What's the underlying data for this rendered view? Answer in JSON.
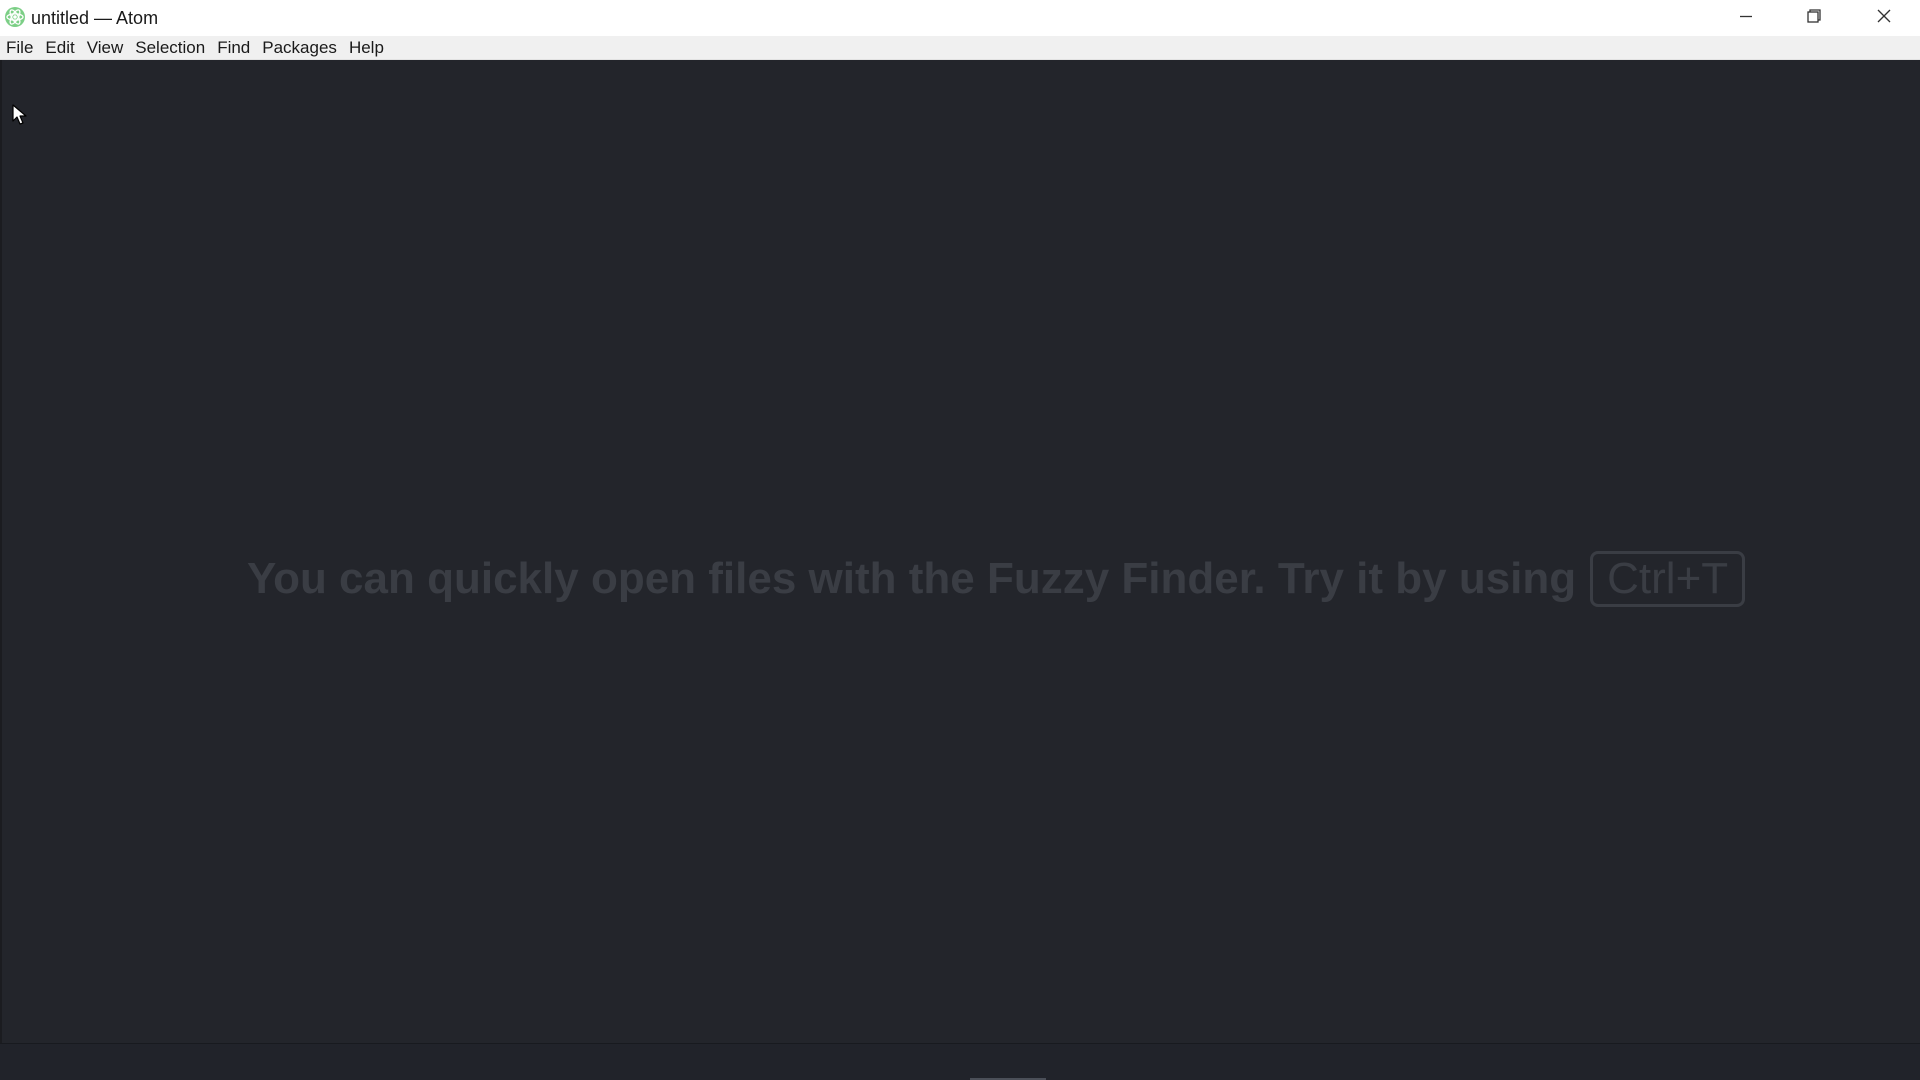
{
  "window": {
    "title": "untitled — Atom",
    "app_icon": "atom-logo-icon",
    "controls": {
      "minimize": "minimize-icon",
      "maximize": "restore-icon",
      "close": "close-icon"
    }
  },
  "menubar": {
    "items": [
      {
        "label": "File"
      },
      {
        "label": "Edit"
      },
      {
        "label": "View"
      },
      {
        "label": "Selection"
      },
      {
        "label": "Find"
      },
      {
        "label": "Packages"
      },
      {
        "label": "Help"
      }
    ]
  },
  "editor": {
    "hint_text": "You can quickly open files with the Fuzzy Finder. Try it by using",
    "shortcut": "Ctrl+T",
    "background_color": "#23252b",
    "hint_color": "#3a3d44"
  },
  "colors": {
    "titlebar_bg": "#ffffff",
    "menubar_bg": "#f0f0f0",
    "atom_green": "#66bb6a"
  }
}
